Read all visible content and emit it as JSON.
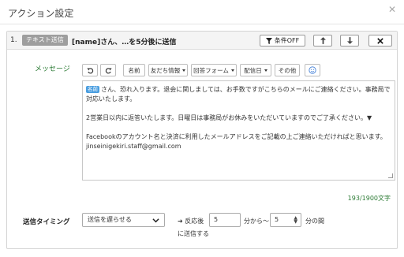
{
  "modal": {
    "title": "アクション設定"
  },
  "action": {
    "index": "1.",
    "type_tag": "テキスト送信",
    "summary": "[name]さん、…を5分後に送信",
    "condition_label": "条件OFF"
  },
  "message": {
    "label": "メッセージ",
    "toolbar": {
      "name": "名前",
      "friend_info": "友だち情報",
      "answer_form": "回答フォーム",
      "delivery_date": "配信日",
      "other": "その他"
    },
    "name_chip": "名前",
    "paragraphs": [
      "さん、恐れ入ります。退会に関しましては、お手数ですがこちらのメールにご連絡ください。事務局で対応いたします。",
      "2営業日以内に返答いたします。日曜日は事務局がお休みをいただいていますのでご了承ください。▼",
      "Facebookのアカウント名と決済に利用したメールアドレスをご記載の上ご連絡いただければと思います。",
      "jinseinigekiri.staff@gmail.com"
    ],
    "char_count": "193/1900文字"
  },
  "timing": {
    "label": "送信タイミング",
    "select_value": "送信を遅らせる",
    "prefix": "➜ 反応後",
    "from_value": "5",
    "between": "分から〜",
    "to_value": "5",
    "after": "分の間",
    "send_text": "に送信する"
  }
}
